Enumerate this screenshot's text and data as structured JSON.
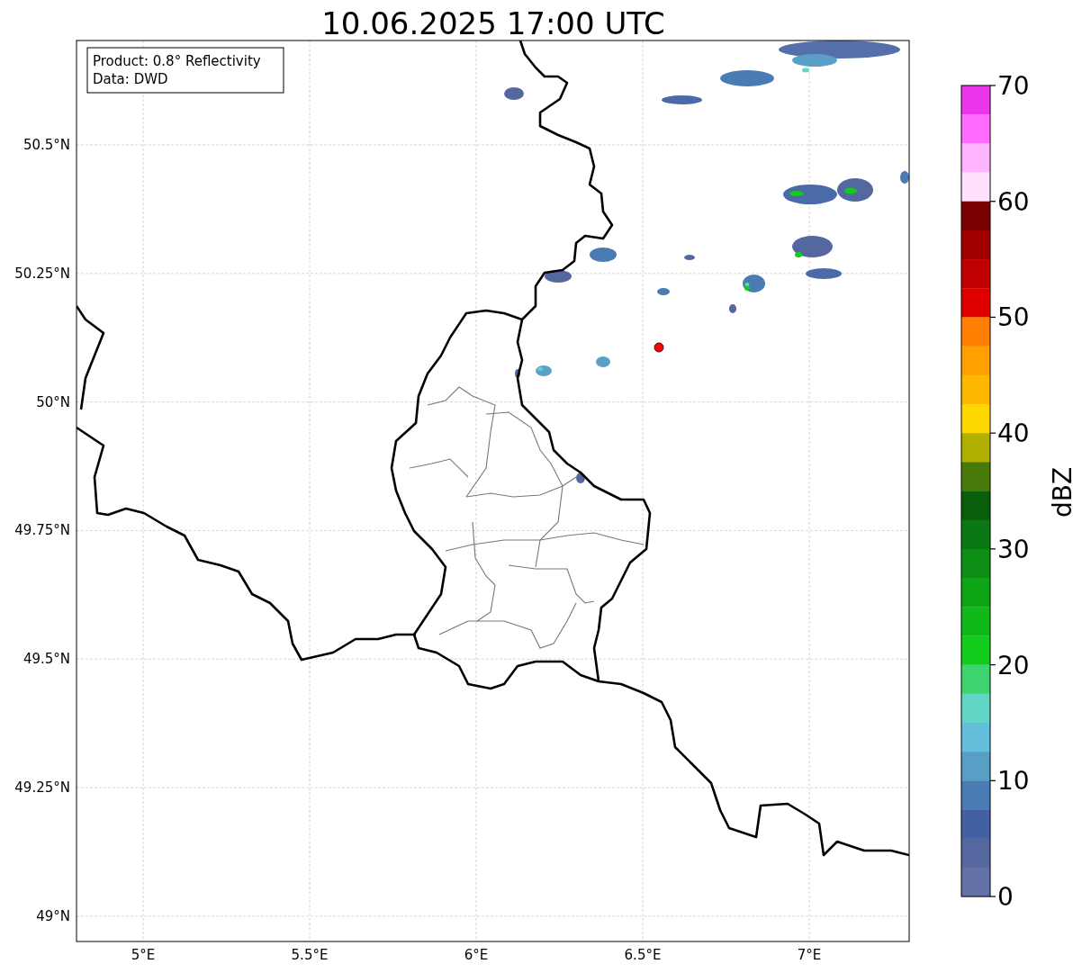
{
  "title": "10.06.2025 17:00 UTC",
  "info_box": {
    "lines": [
      "Product: 0.8° Reflectivity",
      "Data: DWD"
    ]
  },
  "map": {
    "lat_ticks": [
      "50.5°N",
      "50.25°N",
      "50°N",
      "49.75°N",
      "49.5°N",
      "49.25°N",
      "49°N"
    ],
    "lon_ticks": [
      "5°E",
      "5.5°E",
      "6°E",
      "6.5°E",
      "7°E"
    ]
  },
  "colorbar": {
    "label": "dBZ",
    "ticks": [
      "70",
      "60",
      "50",
      "40",
      "30",
      "20",
      "10",
      "0"
    ],
    "bins": [
      {
        "color": "#ec36ec"
      },
      {
        "color": "#ff6cff"
      },
      {
        "color": "#ffb4ff"
      },
      {
        "color": "#ffe0ff"
      },
      {
        "color": "#780000"
      },
      {
        "color": "#a00000"
      },
      {
        "color": "#c00000"
      },
      {
        "color": "#e00000"
      },
      {
        "color": "#ff7f00"
      },
      {
        "color": "#ff9f00"
      },
      {
        "color": "#ffb800"
      },
      {
        "color": "#ffd700"
      },
      {
        "color": "#b0b000"
      },
      {
        "color": "#487a0a"
      },
      {
        "color": "#085e0c"
      },
      {
        "color": "#0a7812"
      },
      {
        "color": "#0c8e14"
      },
      {
        "color": "#0ea514"
      },
      {
        "color": "#10b91a"
      },
      {
        "color": "#11cc1a"
      },
      {
        "color": "#3ed46f"
      },
      {
        "color": "#62d6c6"
      },
      {
        "color": "#64bfdc"
      },
      {
        "color": "#589fc6"
      },
      {
        "color": "#4a7bb2"
      },
      {
        "color": "#4360a3"
      },
      {
        "color": "#54679f"
      },
      {
        "color": "#6472a8"
      }
    ]
  }
}
